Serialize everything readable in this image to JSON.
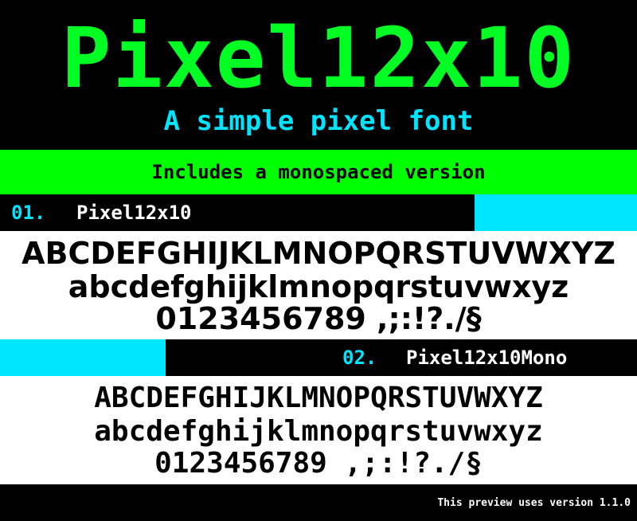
{
  "title": "Pixel12x10",
  "subtitle": "A simple pixel font",
  "banner": "Includes a monospaced version",
  "sections": [
    {
      "number": "01.",
      "name": "Pixel12x10",
      "uppercase": "ABCDEFGHIJKLMNOPQRSTUVWXYZ",
      "lowercase": "abcdefghijklmnopqrstuvwxyz",
      "digits": "0123456789 ,;:!?./§"
    },
    {
      "number": "02.",
      "name": "Pixel12x10Mono",
      "uppercase": "ABCDEFGHIJKLMNOPQRSTUVWXYZ",
      "lowercase": "abcdefghijklmnopqrstuvwxyz",
      "digits": "0123456789 ,;:!?./§"
    }
  ],
  "footer": "This preview uses version 1.1.0",
  "colors": {
    "background": "#000000",
    "title_green": "#00ff22",
    "band_green": "#00ff00",
    "cyan": "#00e5ff",
    "white": "#ffffff"
  }
}
